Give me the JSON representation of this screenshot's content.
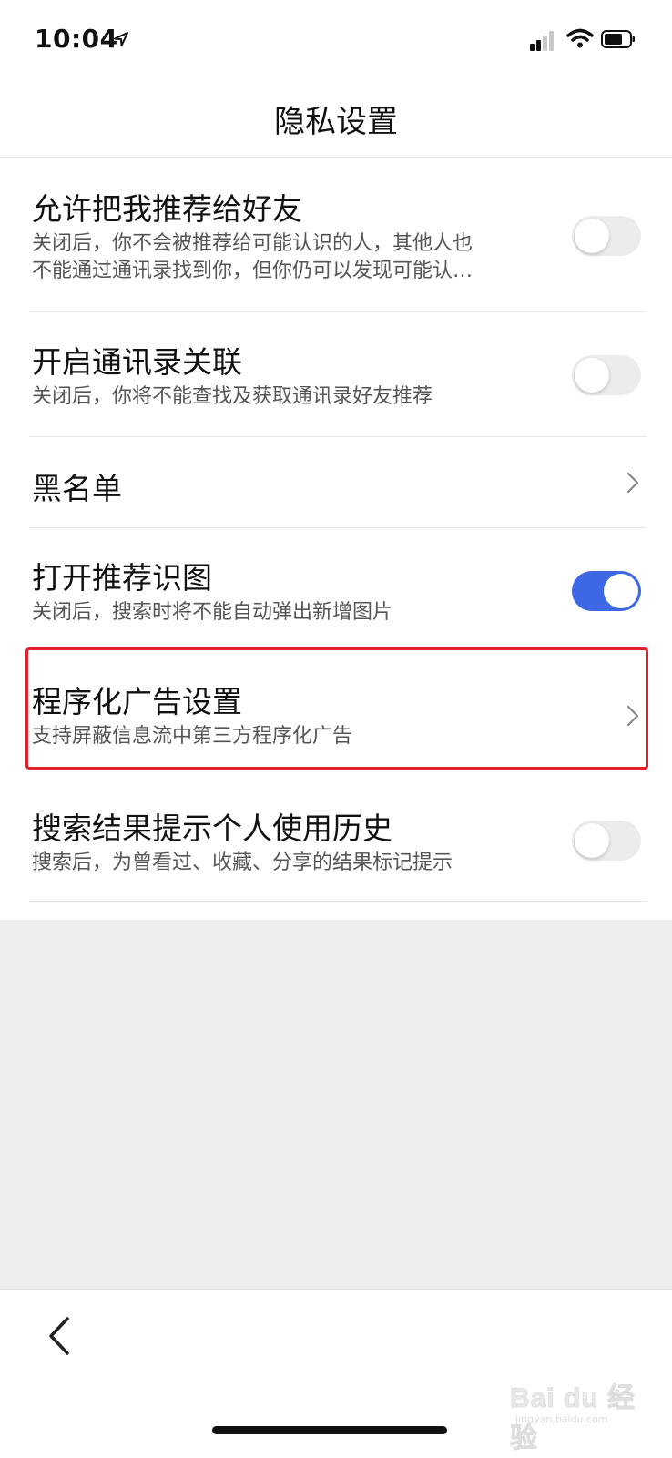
{
  "status_bar": {
    "time": "10:04",
    "icons": [
      "location-arrow-icon",
      "signal-icon",
      "wifi-icon",
      "battery-icon"
    ]
  },
  "nav": {
    "title": "隐私设置"
  },
  "settings": [
    {
      "title": "允许把我推荐给好友",
      "desc_line1": "关闭后，你不会被推荐给可能认识的人，其他人也",
      "desc_line2": "不能通过通讯录找到你，但你仍可以发现可能认…",
      "control": "toggle",
      "on": false
    },
    {
      "title": "开启通讯录关联",
      "desc": "关闭后，你将不能查找及获取通讯录好友推荐",
      "control": "toggle",
      "on": false
    },
    {
      "title": "黑名单",
      "control": "chevron"
    },
    {
      "title": "打开推荐识图",
      "desc": "关闭后，搜索时将不能自动弹出新增图片",
      "control": "toggle",
      "on": true
    },
    {
      "title": "程序化广告设置",
      "desc": "支持屏蔽信息流中第三方程序化广告",
      "control": "chevron",
      "highlighted": true
    },
    {
      "title": "搜索结果提示个人使用历史",
      "desc": "搜索后，为曾看过、收藏、分享的结果标记提示",
      "control": "toggle",
      "on": false
    }
  ],
  "colors": {
    "toggle_on": "#3e67e5",
    "toggle_off": "#ececec",
    "highlight_border": "#e0232a",
    "page_background": "#efedf0"
  },
  "watermark": {
    "text": "Bai du 经验",
    "sub": "jingyan.baidu.com"
  }
}
